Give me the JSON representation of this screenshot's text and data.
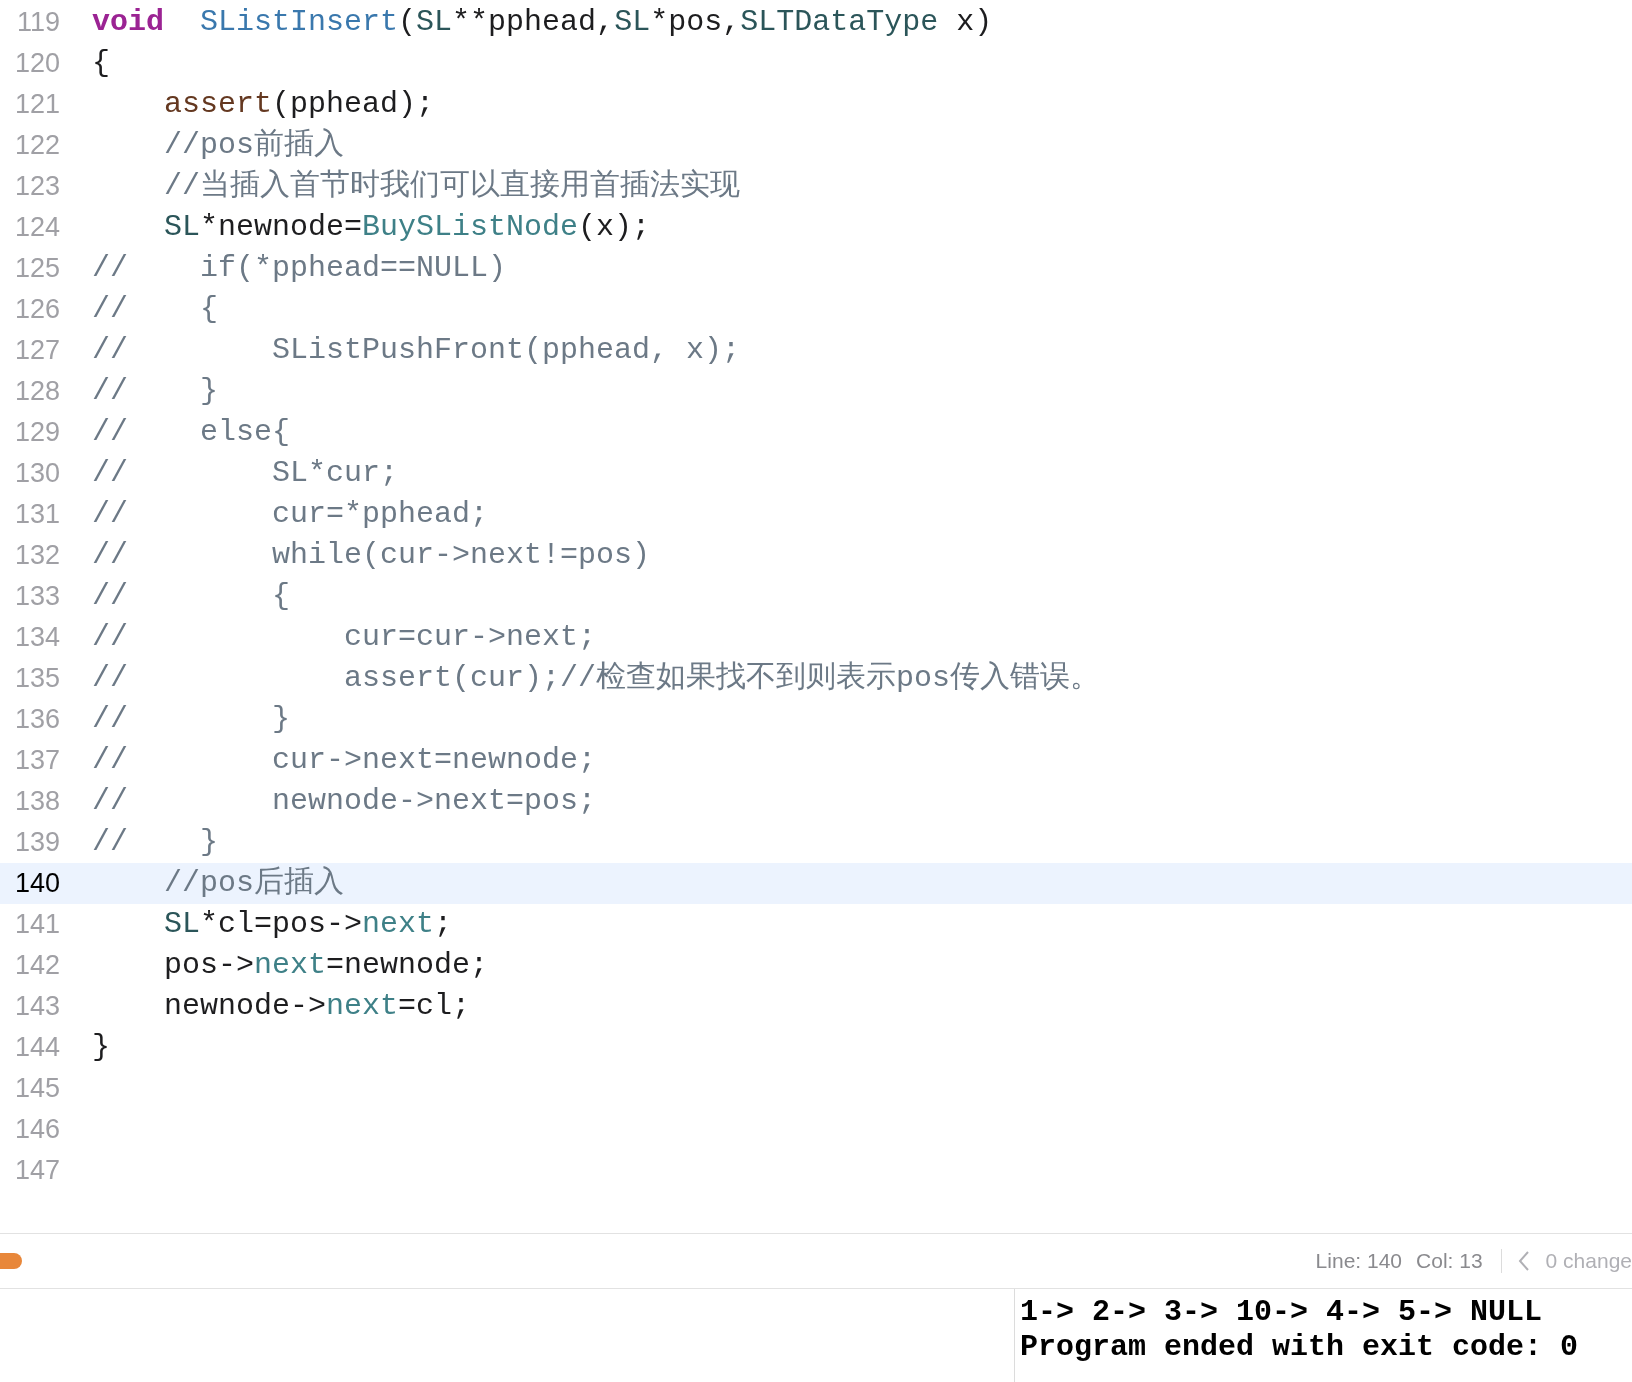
{
  "editor": {
    "lines": [
      {
        "number": "119",
        "current": false,
        "tokens": [
          {
            "text": "void",
            "kind": "keyword"
          },
          {
            "text": "  SListInsert",
            "kind": "function"
          },
          {
            "text": "(",
            "kind": "plain"
          },
          {
            "text": "SL",
            "kind": "type"
          },
          {
            "text": "**pphead,",
            "kind": "plain"
          },
          {
            "text": "SL",
            "kind": "type"
          },
          {
            "text": "*pos,",
            "kind": "plain"
          },
          {
            "text": "SLTDataType",
            "kind": "type"
          },
          {
            "text": " x)",
            "kind": "plain"
          }
        ]
      },
      {
        "number": "120",
        "current": false,
        "tokens": [
          {
            "text": "{",
            "kind": "plain"
          }
        ]
      },
      {
        "number": "121",
        "current": false,
        "tokens": [
          {
            "text": "    assert",
            "kind": "macro"
          },
          {
            "text": "(pphead);",
            "kind": "plain"
          }
        ]
      },
      {
        "number": "122",
        "current": false,
        "tokens": [
          {
            "text": "    //pos前插入",
            "kind": "comment"
          }
        ]
      },
      {
        "number": "123",
        "current": false,
        "tokens": [
          {
            "text": "    //当插入首节时我们可以直接用首插法实现",
            "kind": "comment"
          }
        ]
      },
      {
        "number": "124",
        "current": false,
        "tokens": [
          {
            "text": "    SL",
            "kind": "type"
          },
          {
            "text": "*newnode=",
            "kind": "plain"
          },
          {
            "text": "BuySListNode",
            "kind": "member"
          },
          {
            "text": "(x);",
            "kind": "plain"
          }
        ]
      },
      {
        "number": "125",
        "current": false,
        "tokens": [
          {
            "text": "//    if(*pphead==NULL)",
            "kind": "comment"
          }
        ]
      },
      {
        "number": "126",
        "current": false,
        "tokens": [
          {
            "text": "//    {",
            "kind": "comment"
          }
        ]
      },
      {
        "number": "127",
        "current": false,
        "tokens": [
          {
            "text": "//        SListPushFront(pphead, x);",
            "kind": "comment"
          }
        ]
      },
      {
        "number": "128",
        "current": false,
        "tokens": [
          {
            "text": "//    }",
            "kind": "comment"
          }
        ]
      },
      {
        "number": "129",
        "current": false,
        "tokens": [
          {
            "text": "//    else{",
            "kind": "comment"
          }
        ]
      },
      {
        "number": "130",
        "current": false,
        "tokens": [
          {
            "text": "//        SL*cur;",
            "kind": "comment"
          }
        ]
      },
      {
        "number": "131",
        "current": false,
        "tokens": [
          {
            "text": "//        cur=*pphead;",
            "kind": "comment"
          }
        ]
      },
      {
        "number": "132",
        "current": false,
        "tokens": [
          {
            "text": "//        while(cur->next!=pos)",
            "kind": "comment"
          }
        ]
      },
      {
        "number": "133",
        "current": false,
        "tokens": [
          {
            "text": "//        {",
            "kind": "comment"
          }
        ]
      },
      {
        "number": "134",
        "current": false,
        "tokens": [
          {
            "text": "//            cur=cur->next;",
            "kind": "comment"
          }
        ]
      },
      {
        "number": "135",
        "current": false,
        "tokens": [
          {
            "text": "//            assert(cur);//检查如果找不到则表示pos传入错误。",
            "kind": "comment"
          }
        ]
      },
      {
        "number": "136",
        "current": false,
        "tokens": [
          {
            "text": "//        }",
            "kind": "comment"
          }
        ]
      },
      {
        "number": "137",
        "current": false,
        "tokens": [
          {
            "text": "//        cur->next=newnode;",
            "kind": "comment"
          }
        ]
      },
      {
        "number": "138",
        "current": false,
        "tokens": [
          {
            "text": "//        newnode->next=pos;",
            "kind": "comment"
          }
        ]
      },
      {
        "number": "139",
        "current": false,
        "tokens": [
          {
            "text": "//    }",
            "kind": "comment"
          }
        ]
      },
      {
        "number": "140",
        "current": true,
        "tokens": [
          {
            "text": "    //pos后插入",
            "kind": "comment"
          }
        ]
      },
      {
        "number": "141",
        "current": false,
        "tokens": [
          {
            "text": "    SL",
            "kind": "type"
          },
          {
            "text": "*cl=pos->",
            "kind": "plain"
          },
          {
            "text": "next",
            "kind": "member"
          },
          {
            "text": ";",
            "kind": "plain"
          }
        ]
      },
      {
        "number": "142",
        "current": false,
        "tokens": [
          {
            "text": "    pos->",
            "kind": "plain"
          },
          {
            "text": "next",
            "kind": "member"
          },
          {
            "text": "=newnode;",
            "kind": "plain"
          }
        ]
      },
      {
        "number": "143",
        "current": false,
        "tokens": [
          {
            "text": "    newnode->",
            "kind": "plain"
          },
          {
            "text": "next",
            "kind": "member"
          },
          {
            "text": "=cl;",
            "kind": "plain"
          }
        ]
      },
      {
        "number": "144",
        "current": false,
        "tokens": [
          {
            "text": "}",
            "kind": "plain"
          }
        ]
      },
      {
        "number": "145",
        "current": false
      },
      {
        "number": "146",
        "current": false
      },
      {
        "number": "147",
        "current": false
      }
    ]
  },
  "status_bar": {
    "line": "Line: 140",
    "column": "Col: 13",
    "changes": "0 change"
  },
  "console": {
    "lines": [
      "1-> 2-> 3-> 10-> 4-> 5-> NULL",
      "Program ended with exit code: 0"
    ]
  }
}
